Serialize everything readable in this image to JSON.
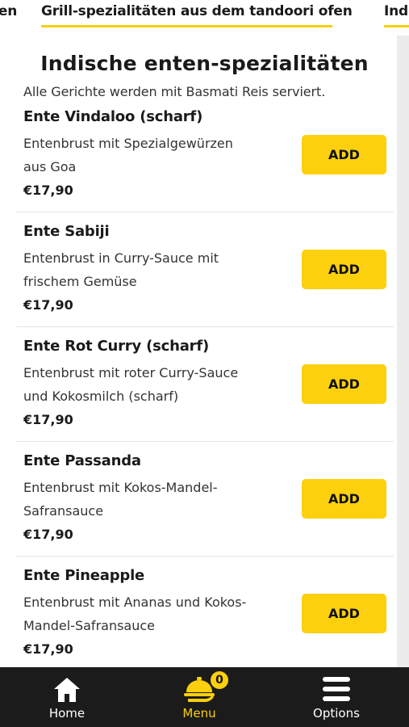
{
  "categories": {
    "prev": "sen",
    "active": "Grill-spezialitäten aus dem tandoori ofen",
    "next": "Ind"
  },
  "section": {
    "title": "Indische enten-spezialitäten",
    "subtitle": "Alle Gerichte werden mit Basmati Reis serviert."
  },
  "items": [
    {
      "name": "Ente Vindaloo (scharf)",
      "desc1": "Entenbrust mit Spezialgewürzen",
      "desc2": "aus Goa",
      "price": "€17,90",
      "add": "ADD"
    },
    {
      "name": "Ente Sabiji",
      "desc1": "Entenbrust in Curry-Sauce mit",
      "desc2": "frischem Gemüse",
      "price": "€17,90",
      "add": "ADD"
    },
    {
      "name": "Ente Rot Curry (scharf)",
      "desc1": "Entenbrust mit roter Curry-Sauce",
      "desc2": "und Kokosmilch (scharf)",
      "price": "€17,90",
      "add": "ADD"
    },
    {
      "name": "Ente Passanda",
      "desc1": "Entenbrust mit Kokos-Mandel-",
      "desc2": "Safransauce",
      "price": "€17,90",
      "add": "ADD"
    },
    {
      "name": "Ente Pineapple",
      "desc1": "Entenbrust mit Ananas und Kokos-",
      "desc2": "Mandel-Safransauce",
      "price": "€17,90",
      "add": "ADD"
    }
  ],
  "nav": {
    "home": "Home",
    "menu": "Menu",
    "options": "Options",
    "cart_count": "0",
    "active_color": "#fcd00d",
    "inactive_color": "#ffffff"
  }
}
